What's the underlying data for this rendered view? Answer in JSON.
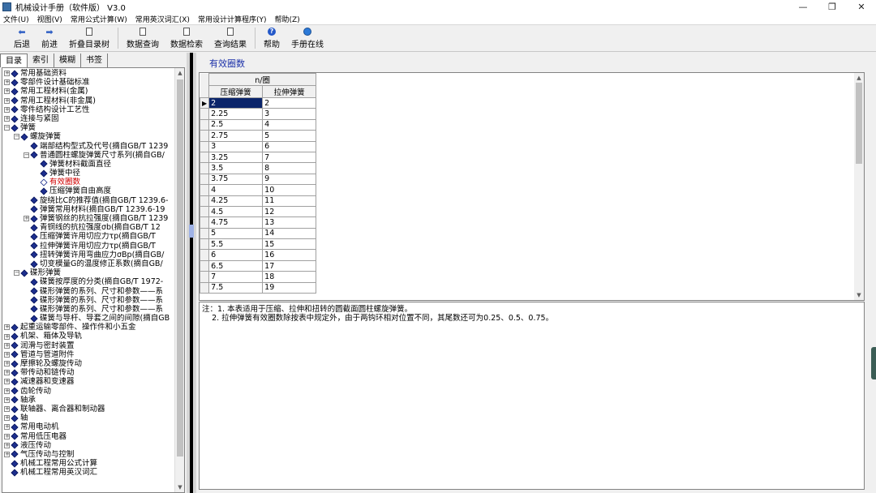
{
  "window": {
    "title": "机械设计手册（软件版） V3.0",
    "controls": [
      "—",
      "❐",
      "✕"
    ]
  },
  "menu": [
    "文件(U)",
    "视图(V)",
    "常用公式计算(W)",
    "常用英汉词汇(X)",
    "常用设计计算程序(Y)",
    "帮助(Z)"
  ],
  "toolbar": {
    "back": "后退",
    "forward": "前进",
    "collapse_toc": "折叠目录树",
    "data_query": "数据查询",
    "data_search": "数据检索",
    "query_results": "查询结果",
    "help": "帮助",
    "manual_online": "手册在线"
  },
  "tabs": [
    "目录",
    "索引",
    "模糊",
    "书签"
  ],
  "tree": [
    {
      "level": 0,
      "expander": "+",
      "label": "常用基础资料"
    },
    {
      "level": 0,
      "expander": "+",
      "label": "零部件设计基础标准"
    },
    {
      "level": 0,
      "expander": "+",
      "label": "常用工程材料(金属)"
    },
    {
      "level": 0,
      "expander": "+",
      "label": "常用工程材料(非金属)"
    },
    {
      "level": 0,
      "expander": "+",
      "label": "零件结构设计工艺性"
    },
    {
      "level": 0,
      "expander": "+",
      "label": "连接与紧固"
    },
    {
      "level": 0,
      "expander": "−",
      "label": "弹簧"
    },
    {
      "level": 1,
      "expander": "−",
      "label": "螺旋弹簧"
    },
    {
      "level": 2,
      "expander": "",
      "label": "端部结构型式及代号(摘自GB/T 1239"
    },
    {
      "level": 2,
      "expander": "−",
      "label": "普通圆柱螺旋弹簧尺寸系列(摘自GB/"
    },
    {
      "level": 3,
      "expander": "",
      "label": "弹簧材料截面直径"
    },
    {
      "level": 3,
      "expander": "",
      "label": "弹簧中径"
    },
    {
      "level": 3,
      "expander": "",
      "label": "有效圈数",
      "selected": true
    },
    {
      "level": 3,
      "expander": "",
      "label": "压缩弹簧自由高度"
    },
    {
      "level": 2,
      "expander": "",
      "label": "旋绕比C的推荐值(摘自GB/T 1239.6-"
    },
    {
      "level": 2,
      "expander": "",
      "label": "弹簧常用材料(摘自GB/T 1239.6-19"
    },
    {
      "level": 2,
      "expander": "+",
      "label": "弹簧钢丝的抗拉强度(摘自GB/T 1239"
    },
    {
      "level": 2,
      "expander": "",
      "label": "青铜线的抗拉强度σb(摘自GB/T 12"
    },
    {
      "level": 2,
      "expander": "",
      "label": "压缩弹簧许用切应力τp(摘自GB/T"
    },
    {
      "level": 2,
      "expander": "",
      "label": "拉伸弹簧许用切应力τp(摘自GB/T"
    },
    {
      "level": 2,
      "expander": "",
      "label": "扭转弹簧许用弯曲应力σBp(摘自GB/"
    },
    {
      "level": 2,
      "expander": "",
      "label": "切变模量G的温度修正系数(摘自GB/"
    },
    {
      "level": 1,
      "expander": "−",
      "label": "碟形弹簧"
    },
    {
      "level": 2,
      "expander": "",
      "label": "碟簧按厚度的分类(摘自GB/T 1972-"
    },
    {
      "level": 2,
      "expander": "",
      "label": "碟形弹簧的系列、尺寸和参数——系"
    },
    {
      "level": 2,
      "expander": "",
      "label": "碟形弹簧的系列、尺寸和参数——系"
    },
    {
      "level": 2,
      "expander": "",
      "label": "碟形弹簧的系列、尺寸和参数——系"
    },
    {
      "level": 2,
      "expander": "",
      "label": "碟簧与导杆、导套之间的间隙(摘自GB"
    },
    {
      "level": 0,
      "expander": "+",
      "label": "起重运输零部件、操作件和小五金"
    },
    {
      "level": 0,
      "expander": "+",
      "label": "机架、箱体及导轨"
    },
    {
      "level": 0,
      "expander": "+",
      "label": "润滑与密封装置"
    },
    {
      "level": 0,
      "expander": "+",
      "label": "管道与管道附件"
    },
    {
      "level": 0,
      "expander": "+",
      "label": "摩擦轮及螺旋传动"
    },
    {
      "level": 0,
      "expander": "+",
      "label": "带传动和链传动"
    },
    {
      "level": 0,
      "expander": "+",
      "label": "减速器和变速器"
    },
    {
      "level": 0,
      "expander": "+",
      "label": "齿轮传动"
    },
    {
      "level": 0,
      "expander": "+",
      "label": "轴承"
    },
    {
      "level": 0,
      "expander": "+",
      "label": "联轴器、离合器和制动器"
    },
    {
      "level": 0,
      "expander": "+",
      "label": "轴"
    },
    {
      "level": 0,
      "expander": "+",
      "label": "常用电动机"
    },
    {
      "level": 0,
      "expander": "+",
      "label": "常用低压电器"
    },
    {
      "level": 0,
      "expander": "+",
      "label": "液压传动"
    },
    {
      "level": 0,
      "expander": "+",
      "label": "气压传动与控制"
    },
    {
      "level": 0,
      "expander": "",
      "label": "机械工程常用公式计算"
    },
    {
      "level": 0,
      "expander": "",
      "label": "机械工程常用英汉词汇"
    }
  ],
  "content": {
    "title": "有效圈数",
    "table": {
      "group_header": "n/圈",
      "columns": [
        "压缩弹簧",
        "拉伸弹簧"
      ],
      "rows": [
        [
          "2",
          "2"
        ],
        [
          "2.25",
          "3"
        ],
        [
          "2.5",
          "4"
        ],
        [
          "2.75",
          "5"
        ],
        [
          "3",
          "6"
        ],
        [
          "3.25",
          "7"
        ],
        [
          "3.5",
          "8"
        ],
        [
          "3.75",
          "9"
        ],
        [
          "4",
          "10"
        ],
        [
          "4.25",
          "11"
        ],
        [
          "4.5",
          "12"
        ],
        [
          "4.75",
          "13"
        ],
        [
          "5",
          "14"
        ],
        [
          "5.5",
          "15"
        ],
        [
          "6",
          "16"
        ],
        [
          "6.5",
          "17"
        ],
        [
          "7",
          "18"
        ],
        [
          "7.5",
          "19"
        ]
      ],
      "current_row_marker": "▶"
    },
    "notes": [
      "注：1. 本表适用于压缩、拉伸和扭转的圆截面圆柱螺旋弹簧。",
      "    2. 拉伸弹簧有效圈数除按表中规定外，由于两钩环相对位置不同，其尾数还可为0.25、0.5、0.75。"
    ]
  },
  "colors": {
    "selected_node": "#d00000",
    "section_title": "#1a2fa8",
    "node_icon": "#1d2f8e",
    "grid_current_cell": "#0a246a"
  }
}
